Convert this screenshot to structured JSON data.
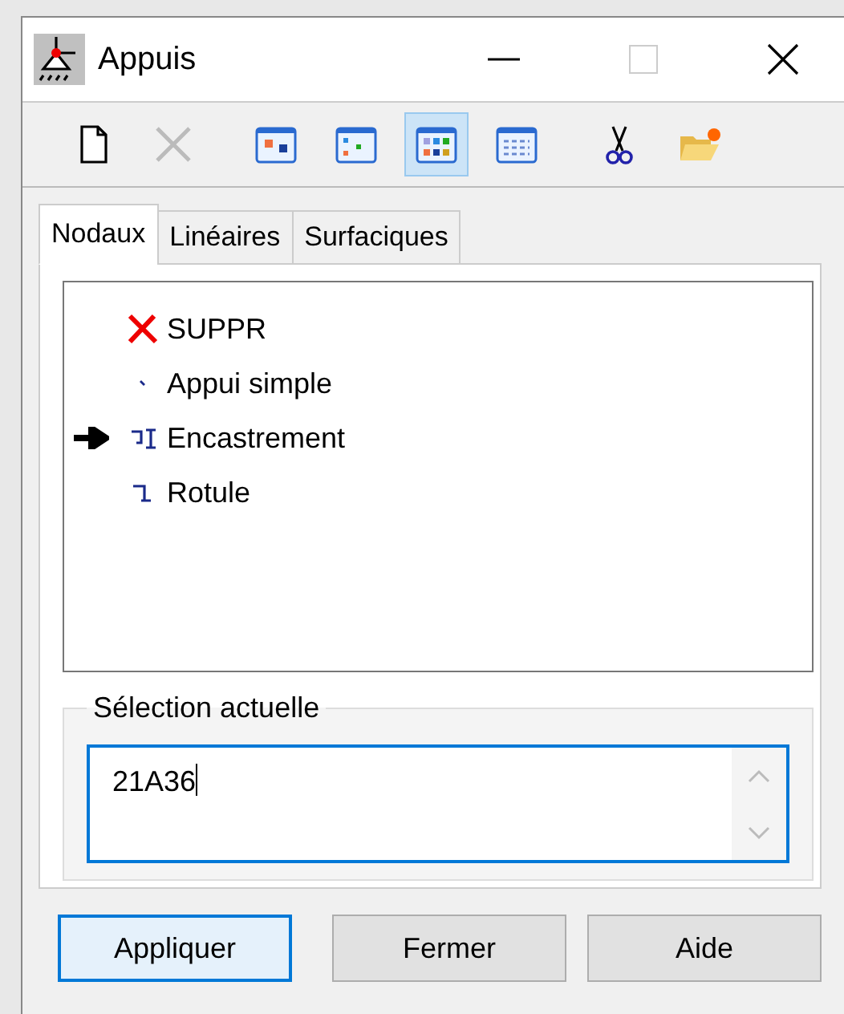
{
  "window": {
    "title": "Appuis"
  },
  "toolbar": [
    {
      "kind": "new",
      "selected": false,
      "disabled": false
    },
    {
      "kind": "delete",
      "selected": false,
      "disabled": true
    },
    {
      "kind": "view1",
      "selected": false,
      "disabled": false
    },
    {
      "kind": "view2",
      "selected": false,
      "disabled": false
    },
    {
      "kind": "view3",
      "selected": true,
      "disabled": false
    },
    {
      "kind": "view4",
      "selected": false,
      "disabled": false
    },
    {
      "kind": "cut",
      "selected": false,
      "disabled": false
    },
    {
      "kind": "open",
      "selected": false,
      "disabled": false
    }
  ],
  "tabs": [
    {
      "label": "Nodaux",
      "selected": true
    },
    {
      "label": "Linéaires",
      "selected": false
    },
    {
      "label": "Surfaciques",
      "selected": false
    }
  ],
  "items": [
    {
      "kind": "delete",
      "label": "SUPPR",
      "current": false
    },
    {
      "kind": "simple",
      "label": "Appui simple",
      "current": false
    },
    {
      "kind": "fixed",
      "label": "Encastrement",
      "current": true
    },
    {
      "kind": "hinge",
      "label": "Rotule",
      "current": false
    }
  ],
  "selection": {
    "label": "Sélection actuelle",
    "value": "21A36"
  },
  "buttons": [
    {
      "label": "Appliquer",
      "default": true
    },
    {
      "label": "Fermer",
      "default": false
    },
    {
      "label": "Aide",
      "default": false
    }
  ]
}
